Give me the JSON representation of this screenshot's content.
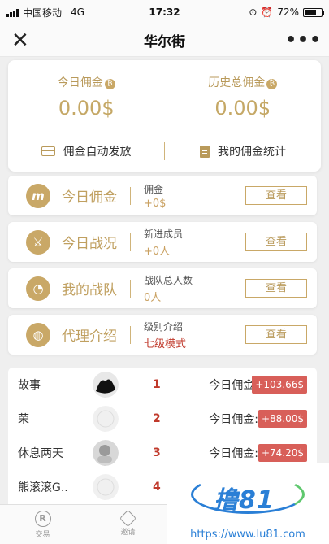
{
  "status": {
    "carrier": "中国移动",
    "network": "4G",
    "time": "17:32",
    "battery": "72%"
  },
  "nav": {
    "title": "华尔街"
  },
  "summary": {
    "today_label": "今日佣金",
    "today_value": "0.00$",
    "total_label": "历史总佣金",
    "total_value": "0.00$",
    "link_auto": "佣金自动发放",
    "link_stats": "我的佣金统计"
  },
  "rows": [
    {
      "title": "今日佣金",
      "sub": "佣金",
      "value": "+0$",
      "button": "查看",
      "icon": "m-logo-icon"
    },
    {
      "title": "今日战况",
      "sub": "新进成员",
      "value": "+0人",
      "button": "查看",
      "icon": "battle-icon"
    },
    {
      "title": "我的战队",
      "sub": "战队总人数",
      "value": "0人",
      "button": "查看",
      "icon": "pie-chart-icon"
    },
    {
      "title": "代理介绍",
      "sub": "级别介绍",
      "value": "七级模式",
      "button": "查看",
      "icon": "globe-icon"
    }
  ],
  "ranking": [
    {
      "name": "故事",
      "rank": "1",
      "label": "今日佣金:",
      "amount": "+103.66$"
    },
    {
      "name": "荣",
      "rank": "2",
      "label": "今日佣金:",
      "amount": "+88.00$"
    },
    {
      "name": "休息两天",
      "rank": "3",
      "label": "今日佣金:",
      "amount": "+74.20$"
    },
    {
      "name": "熊滚滚G..",
      "rank": "4"
    }
  ],
  "tabs": [
    {
      "label": "交易"
    },
    {
      "label": "邀请"
    }
  ],
  "watermark": {
    "logo": "撸81",
    "url": "https://www.lu81.com"
  },
  "colors": {
    "gold": "#c9a867",
    "red": "#c0392b",
    "badge": "#d85f59"
  }
}
